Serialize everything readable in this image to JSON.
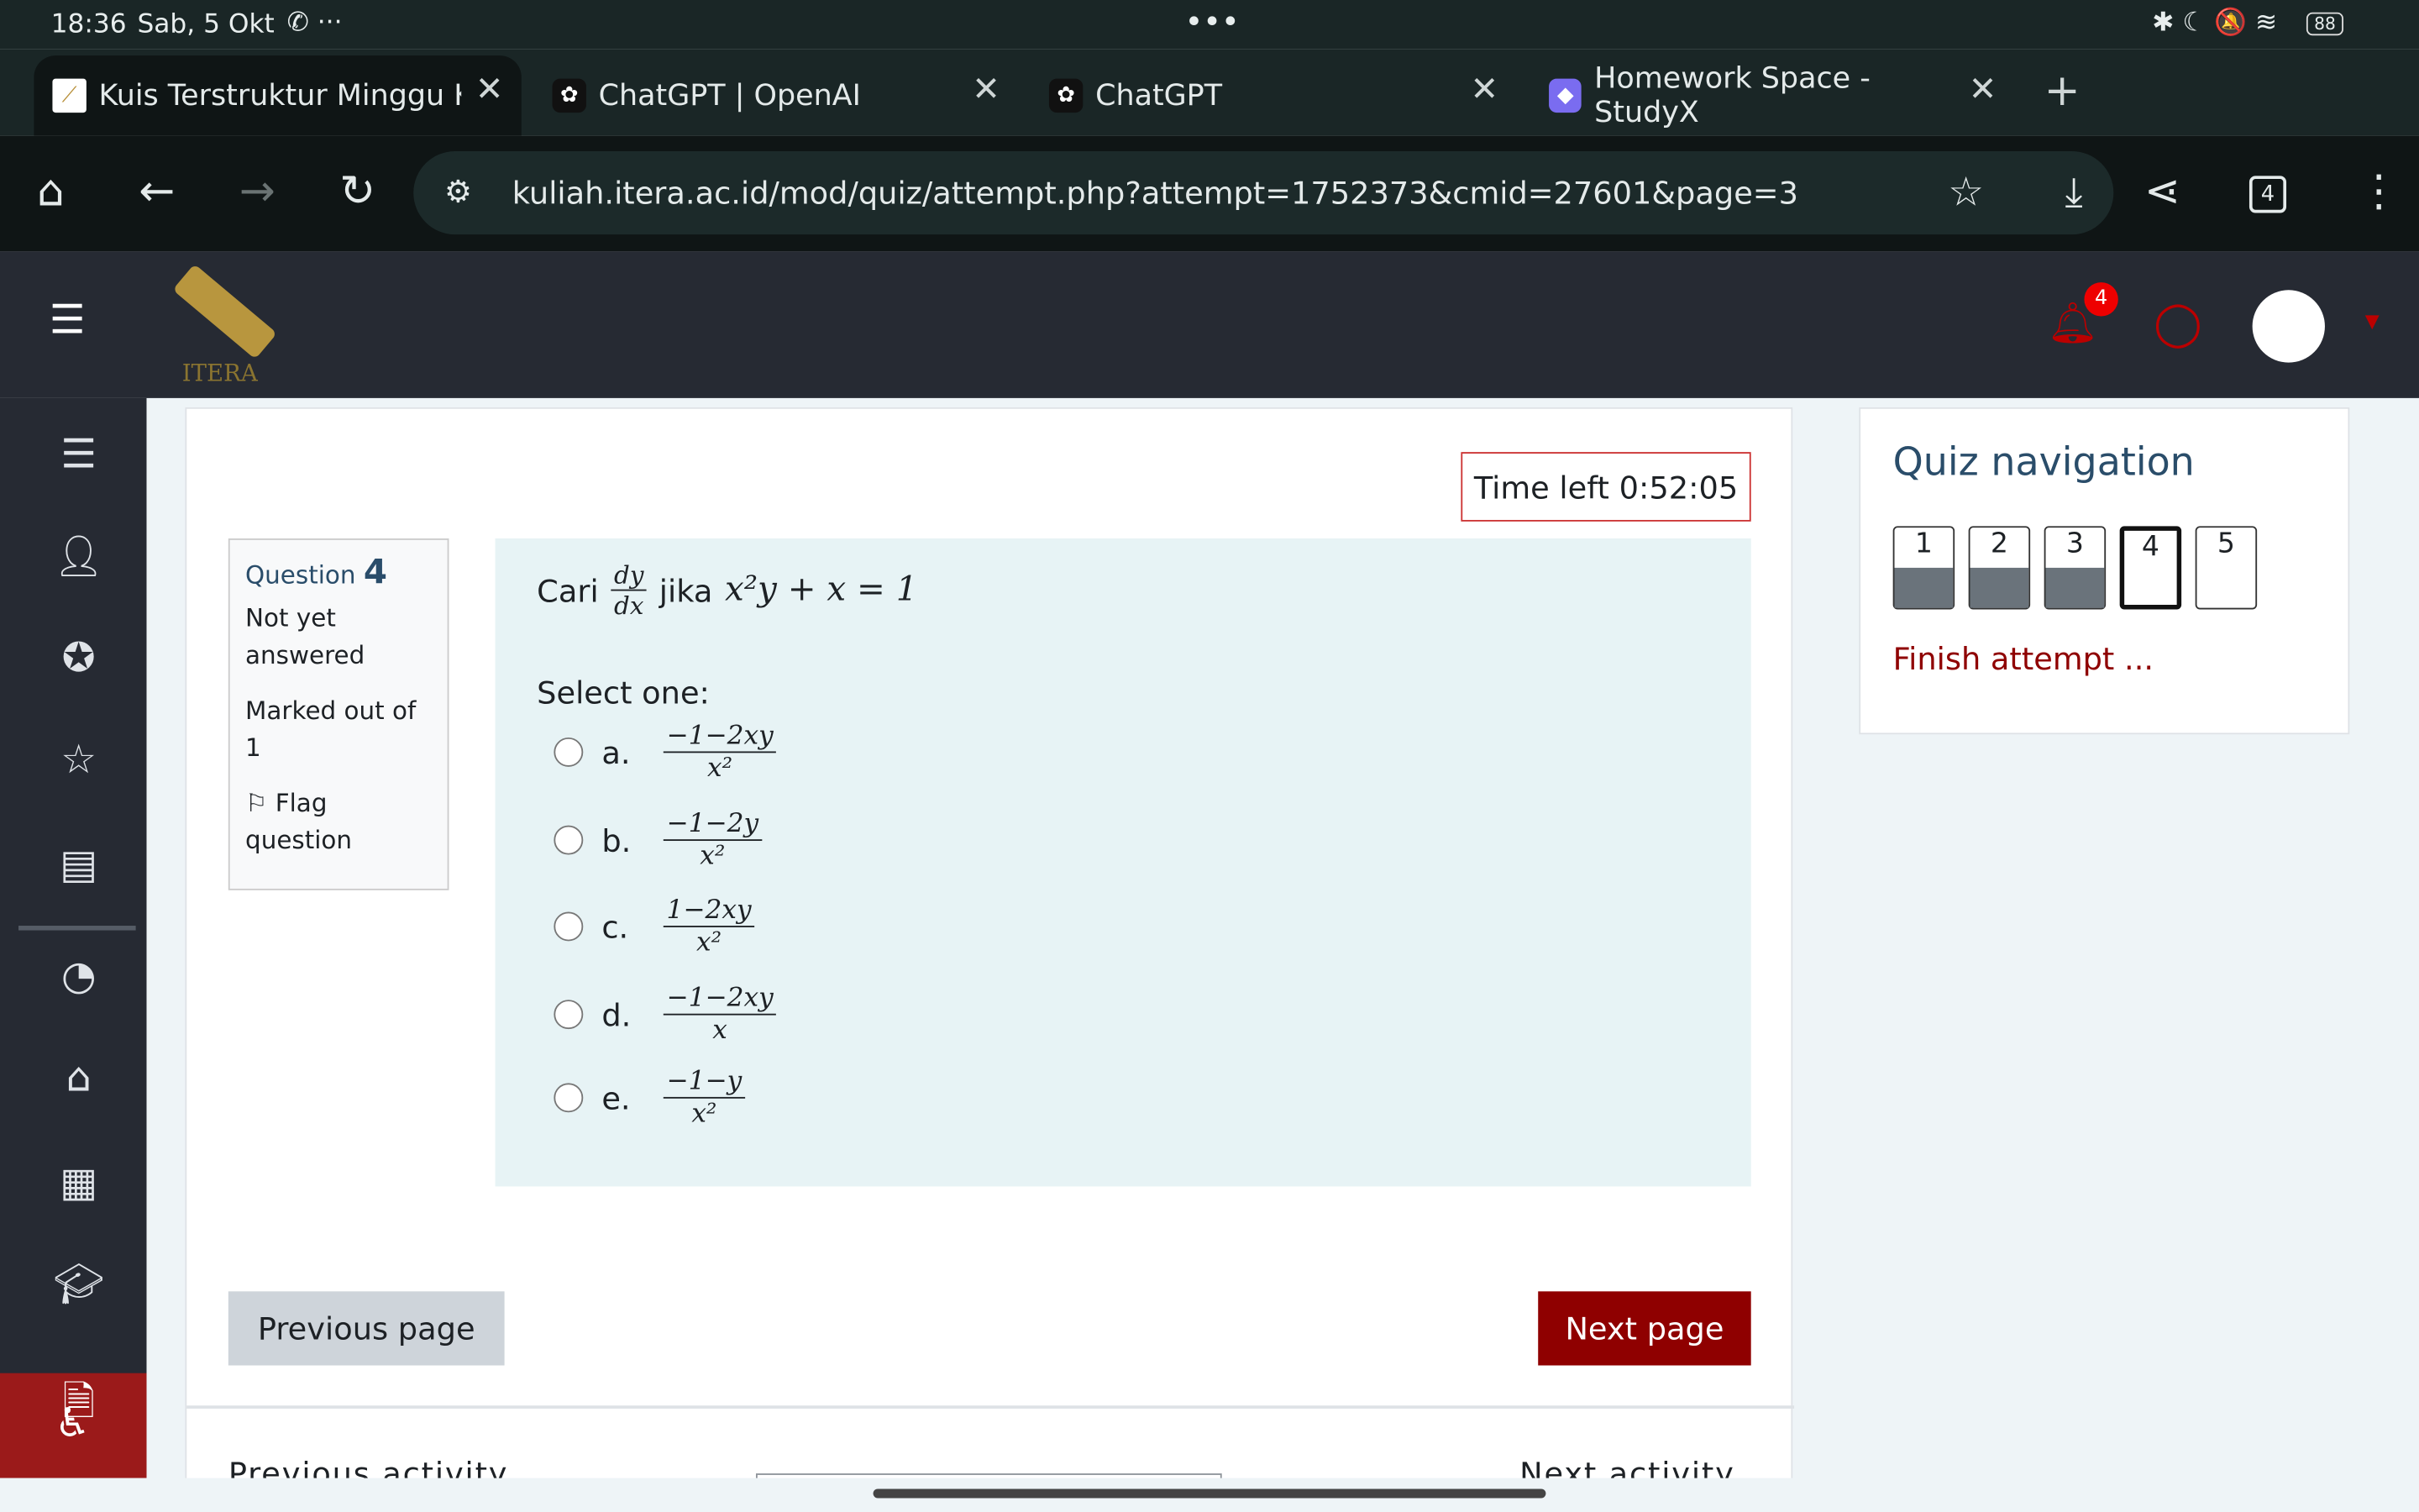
{
  "status_bar": {
    "time": "18:36",
    "date": "Sab, 5 Okt",
    "battery": "88"
  },
  "tabs": [
    {
      "title": "Kuis Terstruktur Minggu Ke-",
      "active": true
    },
    {
      "title": "ChatGPT | OpenAI"
    },
    {
      "title": "ChatGPT"
    },
    {
      "title": "Homework Space - StudyX"
    }
  ],
  "tab_count": "4",
  "url": "kuliah.itera.ac.id/mod/quiz/attempt.php?attempt=1752373&cmid=27601&page=3",
  "header": {
    "logo_text": "ITERA",
    "notification_count": "4"
  },
  "timer": "Time left 0:52:05",
  "question": {
    "label": "Question",
    "number": "4",
    "state": "Not yet answered",
    "marked": "Marked out of 1",
    "flag": "Flag question",
    "prompt_word": "Cari",
    "deriv_num": "dy",
    "deriv_den": "dx",
    "jika": "jika",
    "equation": "x²y + x = 1",
    "select_one": "Select one:",
    "options": [
      {
        "letter": "a.",
        "num": "−1−2xy",
        "den": "x²"
      },
      {
        "letter": "b.",
        "num": "−1−2y",
        "den": "x²"
      },
      {
        "letter": "c.",
        "num": "1−2xy",
        "den": "x²"
      },
      {
        "letter": "d.",
        "num": "−1−2xy",
        "den": "x"
      },
      {
        "letter": "e.",
        "num": "−1−y",
        "den": "x²"
      }
    ]
  },
  "buttons": {
    "previous": "Previous page",
    "next": "Next page"
  },
  "activity": {
    "previous": "Previous activity",
    "next": "Next activity"
  },
  "quiz_nav": {
    "title": "Quiz navigation",
    "items": [
      {
        "n": "1",
        "answered": true
      },
      {
        "n": "2",
        "answered": true
      },
      {
        "n": "3",
        "answered": true
      },
      {
        "n": "4",
        "current": true
      },
      {
        "n": "5"
      }
    ],
    "finish": "Finish attempt ..."
  },
  "colors": {
    "brand": "#8f0000",
    "header": "#262a33",
    "question_bg": "#e7f3f5"
  }
}
